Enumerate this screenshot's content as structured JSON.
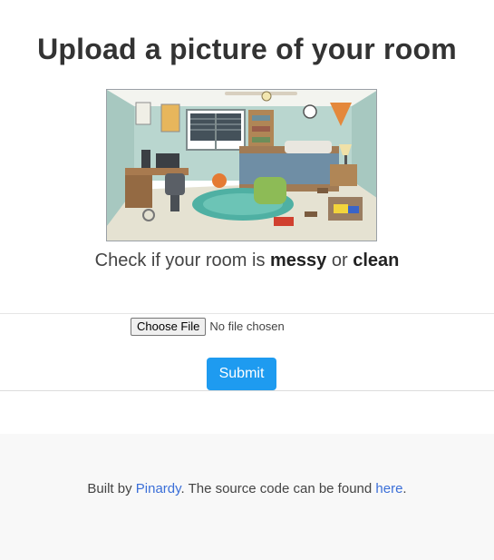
{
  "header": {
    "title": "Upload a picture of your room"
  },
  "hero": {
    "alt": "Illustration of a messy bedroom"
  },
  "prompt": {
    "prefix": "Check if your room is ",
    "messy": "messy",
    "middle": " or ",
    "clean": "clean"
  },
  "upload": {
    "choose_label": "Choose File",
    "status": "No file chosen",
    "submit_label": "Submit"
  },
  "footer": {
    "prefix": "Built by ",
    "author_link": "Pinardy",
    "middle": ". The source code can be found ",
    "source_link": "here",
    "suffix": "."
  },
  "colors": {
    "submit_bg": "#1e9bf0",
    "link": "#3b6fd8",
    "footer_bg": "#f8f8f8"
  }
}
